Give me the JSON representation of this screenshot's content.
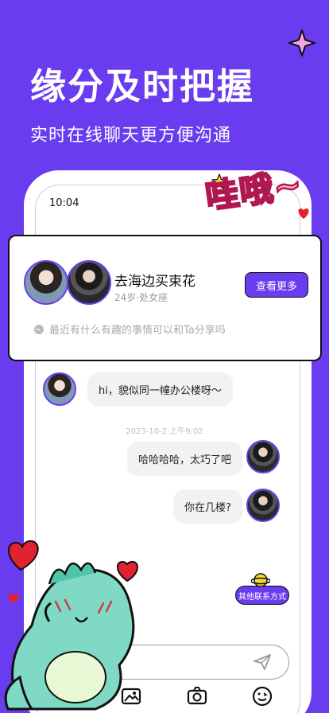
{
  "promo": {
    "headline": "缘分及时把握",
    "subline": "实时在线聊天更方便沟通",
    "sticker_text": "哇哦~"
  },
  "status_bar": {
    "time": "10:04"
  },
  "profile_card": {
    "name": "去海边买束花",
    "meta": "24岁·处女座",
    "view_more_label": "查看更多",
    "latest_message": "最近有什么有趣的事情可以和Ta分享吗"
  },
  "chat": {
    "messages": [
      {
        "side": "left",
        "text": "hi，貌似同一幢办公楼呀～"
      },
      {
        "side": "right",
        "text": "哈哈哈哈，太巧了吧"
      },
      {
        "side": "right",
        "text": "你在几楼?"
      }
    ],
    "timestamp": "2023-10-2 上午9:02",
    "other_contact_label": "其他联系方式"
  },
  "toolbar": {
    "icons": [
      "bag-icon",
      "image-icon",
      "camera-icon",
      "emoji-icon"
    ]
  },
  "colors": {
    "brand": "#6a3cf0",
    "sticker_pink": "#ffb8cc",
    "sticker_stroke": "#b21850"
  }
}
